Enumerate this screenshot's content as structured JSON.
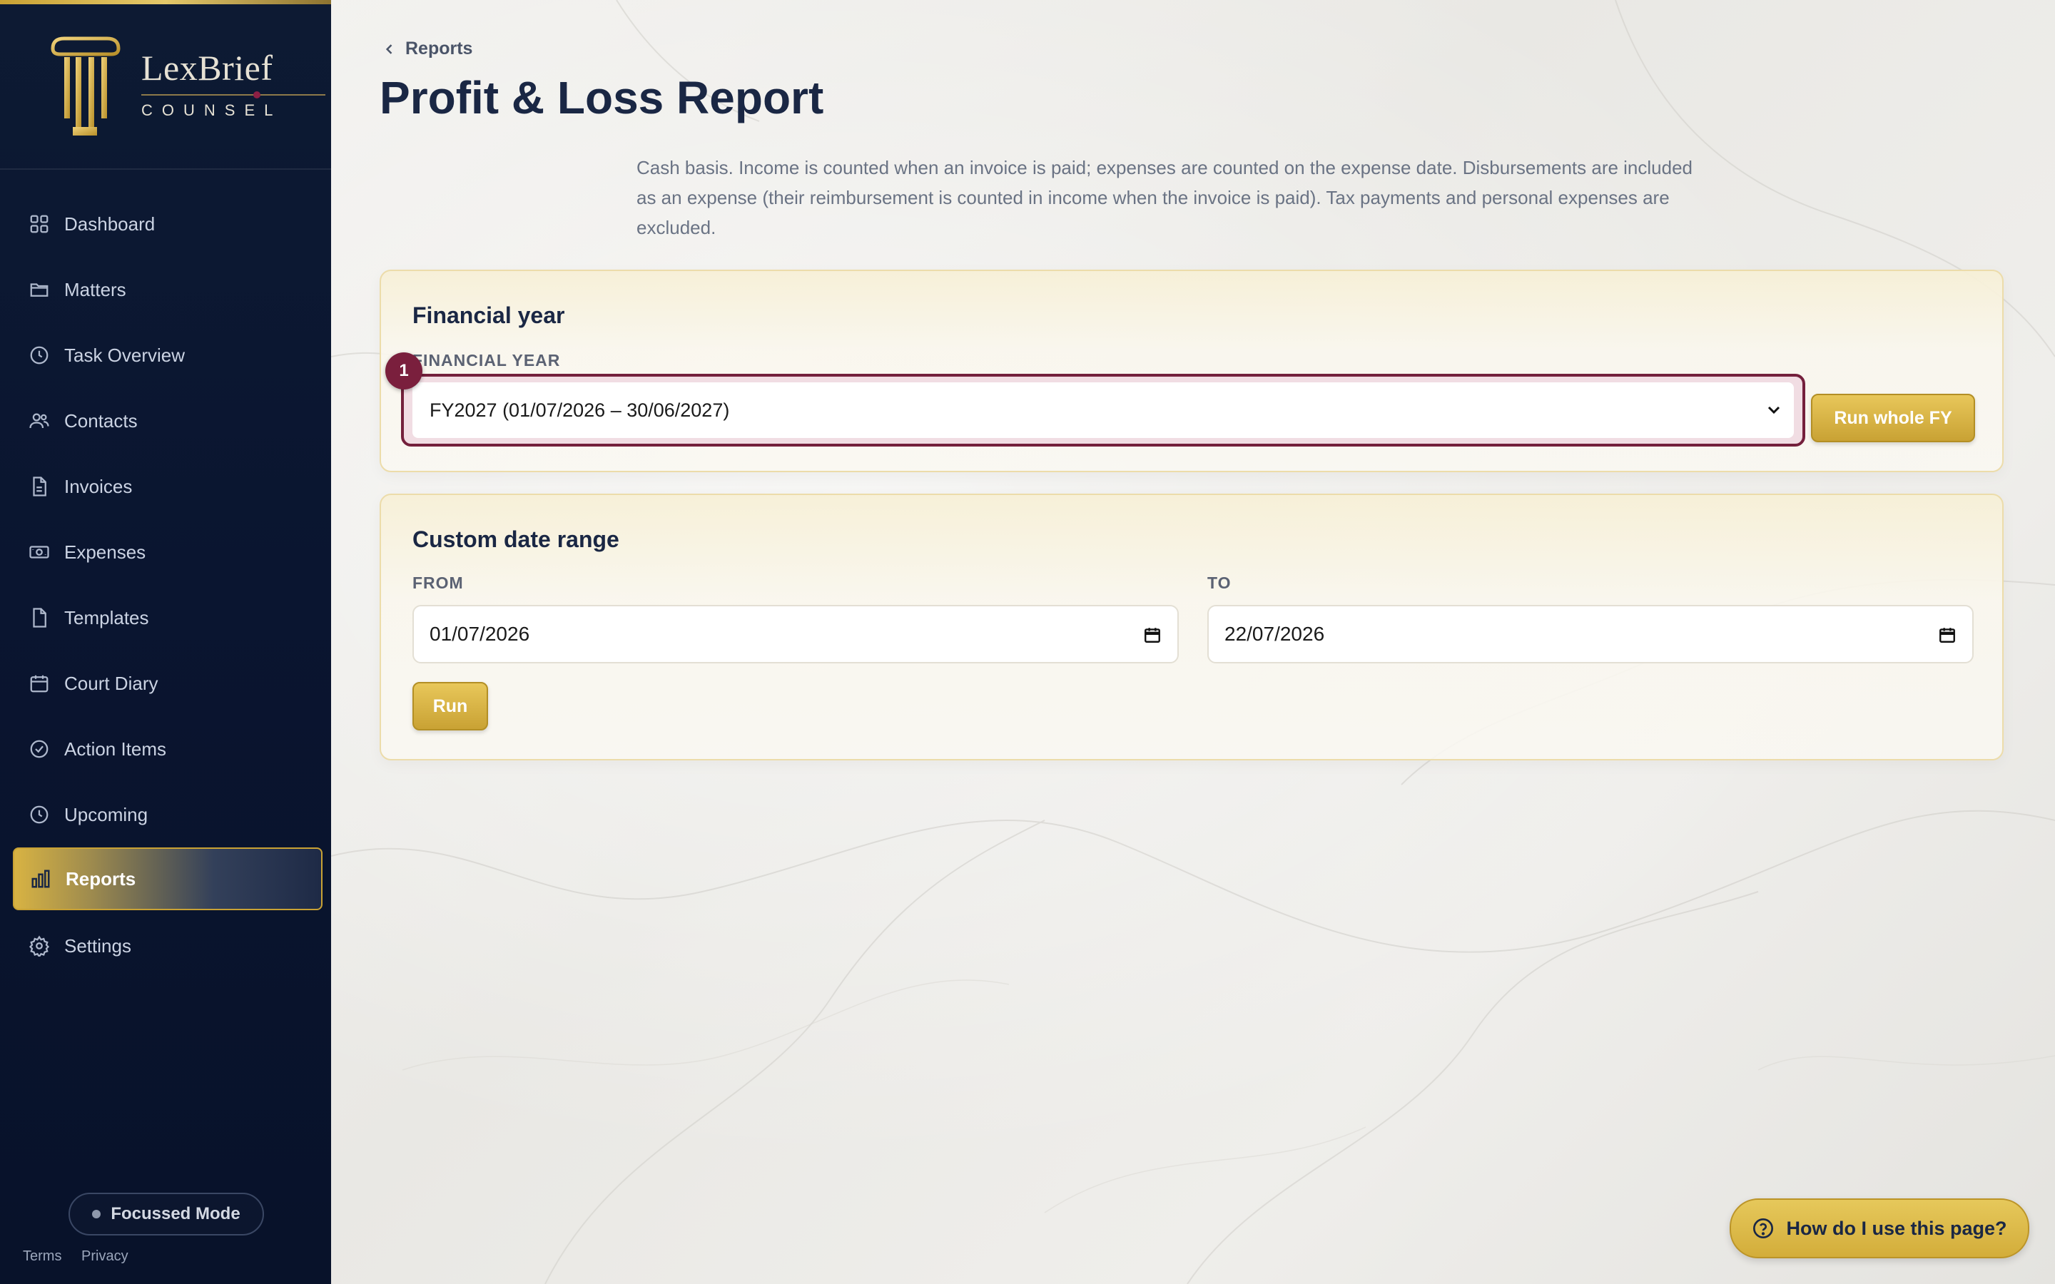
{
  "brand": {
    "name": "LexBrief",
    "sub": "COUNSEL"
  },
  "nav": [
    {
      "label": "Dashboard",
      "icon": "dashboard-icon"
    },
    {
      "label": "Matters",
      "icon": "folder-icon"
    },
    {
      "label": "Task Overview",
      "icon": "clock-icon"
    },
    {
      "label": "Contacts",
      "icon": "users-icon"
    },
    {
      "label": "Invoices",
      "icon": "document-icon"
    },
    {
      "label": "Expenses",
      "icon": "banknote-icon"
    },
    {
      "label": "Templates",
      "icon": "file-icon"
    },
    {
      "label": "Court Diary",
      "icon": "calendar-icon"
    },
    {
      "label": "Action Items",
      "icon": "check-circle-icon"
    },
    {
      "label": "Upcoming",
      "icon": "clock-icon"
    },
    {
      "label": "Reports",
      "icon": "bar-chart-icon",
      "active": true
    },
    {
      "label": "Settings",
      "icon": "gear-icon"
    }
  ],
  "focus_mode_label": "Focussed Mode",
  "footer": {
    "terms": "Terms",
    "privacy": "Privacy"
  },
  "breadcrumb": "Reports",
  "page_title": "Profit & Loss Report",
  "description": "Cash basis. Income is counted when an invoice is paid; expenses are counted on the expense date. Disbursements are included as an expense (their reimbursement is counted in income when the invoice is paid). Tax payments and personal expenses are excluded.",
  "fy_card": {
    "title": "Financial year",
    "field_label": "FINANCIAL YEAR",
    "selected": "FY2027 (01/07/2026 – 30/06/2027)",
    "badge": "1",
    "run_button": "Run whole FY"
  },
  "custom_card": {
    "title": "Custom date range",
    "from_label": "FROM",
    "from_value": "01/07/2026",
    "to_label": "TO",
    "to_value": "22/07/2026",
    "run_button": "Run"
  },
  "help_button": "How do I use this page?",
  "colors": {
    "accent_gold": "#c9a234",
    "highlight_maroon": "#74203c",
    "navy": "#0d1a33"
  }
}
